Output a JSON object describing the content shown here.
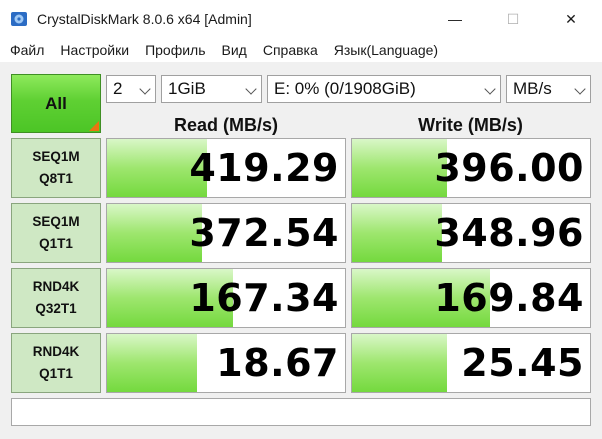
{
  "window": {
    "title": "CrystalDiskMark 8.0.6 x64 [Admin]",
    "icon": "crystaldiskmark-disk-icon",
    "controls": {
      "minimize": "—",
      "maximize": "☐",
      "close": "✕"
    }
  },
  "menu": [
    "Файл",
    "Настройки",
    "Профиль",
    "Вид",
    "Справка",
    "Язык(Language)"
  ],
  "toolbar": {
    "all_label": "All",
    "count": "2",
    "size": "1GiB",
    "drive": "E: 0% (0/1908GiB)",
    "unit": "MB/s"
  },
  "headers": {
    "read": "Read (MB/s)",
    "write": "Write (MB/s)"
  },
  "rows": [
    {
      "line1": "SEQ1M",
      "line2": "Q8T1",
      "read": "419.29",
      "write": "396.00",
      "read_fill": 0.42,
      "write_fill": 0.4
    },
    {
      "line1": "SEQ1M",
      "line2": "Q1T1",
      "read": "372.54",
      "write": "348.96",
      "read_fill": 0.4,
      "write_fill": 0.38
    },
    {
      "line1": "RND4K",
      "line2": "Q32T1",
      "read": "167.34",
      "write": "169.84",
      "read_fill": 0.53,
      "write_fill": 0.58
    },
    {
      "line1": "RND4K",
      "line2": "Q1T1",
      "read": "18.67",
      "write": "25.45",
      "read_fill": 0.38,
      "write_fill": 0.4
    }
  ],
  "comment": "",
  "colors": {
    "accent_green": "#5fd033",
    "corner_orange": "#e87511",
    "label_bg": "#cfe8c4"
  }
}
